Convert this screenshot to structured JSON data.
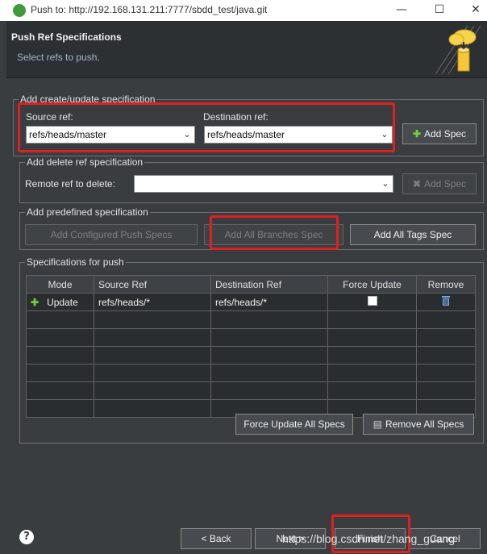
{
  "window": {
    "title": "Push to: http://192.168.131.211:7777/sbdd_test/java.git",
    "minimize_glyph": "—",
    "maximize_glyph": "☐",
    "close_glyph": "✕"
  },
  "header": {
    "title": "Push Ref Specifications",
    "subtitle": "Select refs to push."
  },
  "create_group": {
    "legend": "Add create/update specification",
    "source_label": "Source ref:",
    "source_value": "refs/heads/master",
    "dest_label": "Destination ref:",
    "dest_value": "refs/heads/master",
    "add_spec_label": "Add Spec"
  },
  "delete_group": {
    "legend": "Add delete ref specification",
    "remote_label": "Remote ref to delete:",
    "remote_value": "",
    "add_spec_label": "Add Spec"
  },
  "predefined_group": {
    "legend": "Add predefined specification",
    "configured_label": "Add Configured Push Specs",
    "branches_label": "Add All Branches Spec",
    "tags_label": "Add All Tags Spec"
  },
  "specs_group": {
    "legend": "Specifications for push",
    "columns": [
      "Mode",
      "Source Ref",
      "Destination Ref",
      "Force Update",
      "Remove"
    ],
    "row": {
      "mode": "Update",
      "source": "refs/heads/*",
      "dest": "refs/heads/*",
      "force": false
    },
    "force_all_label": "Force Update All Specs",
    "remove_all_label": "Remove All Specs"
  },
  "footer": {
    "help_glyph": "?",
    "back_label": "< Back",
    "next_label": "Next >",
    "finish_label": "Finish",
    "cancel_label": "Cancel",
    "watermark": "https://blog.csdn.net/zhang_guang"
  },
  "colors": {
    "background": "#3a3d40",
    "highlight": "#e02020",
    "add_icon": "#6fcf3a"
  }
}
